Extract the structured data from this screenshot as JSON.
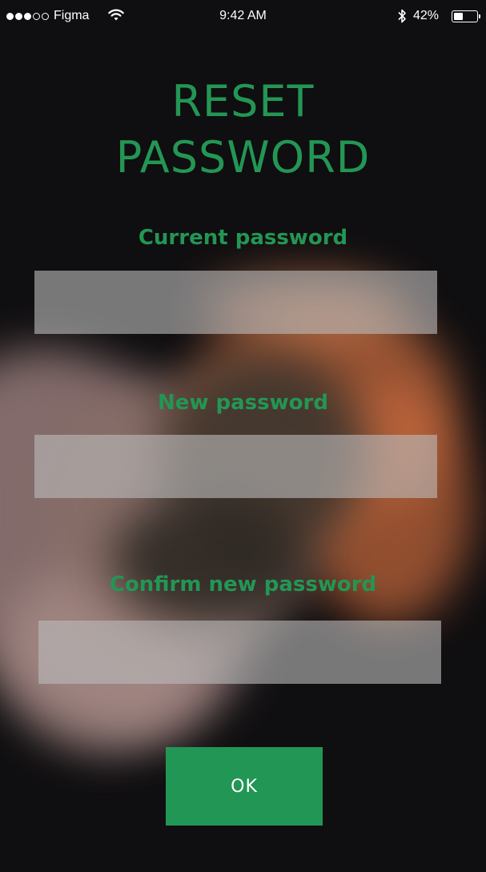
{
  "status_bar": {
    "carrier": "Figma",
    "time": "9:42 AM",
    "battery_percent": "42%",
    "battery_level": 0.42,
    "signal_icons": [
      "signal-dots-icon",
      "wifi-icon",
      "bluetooth-icon",
      "battery-icon"
    ]
  },
  "title": {
    "line1": "RESET",
    "line2": "PASSWORD"
  },
  "form": {
    "current_label": "Current password",
    "current_value": "",
    "new_label": "New password",
    "new_value": "",
    "confirm_label": "Confirm new password",
    "confirm_value": ""
  },
  "actions": {
    "ok_label": "OK"
  },
  "colors": {
    "accent": "#239654",
    "field_fill": "rgba(185,185,185,0.62)",
    "text_on_button": "#ffffff"
  }
}
